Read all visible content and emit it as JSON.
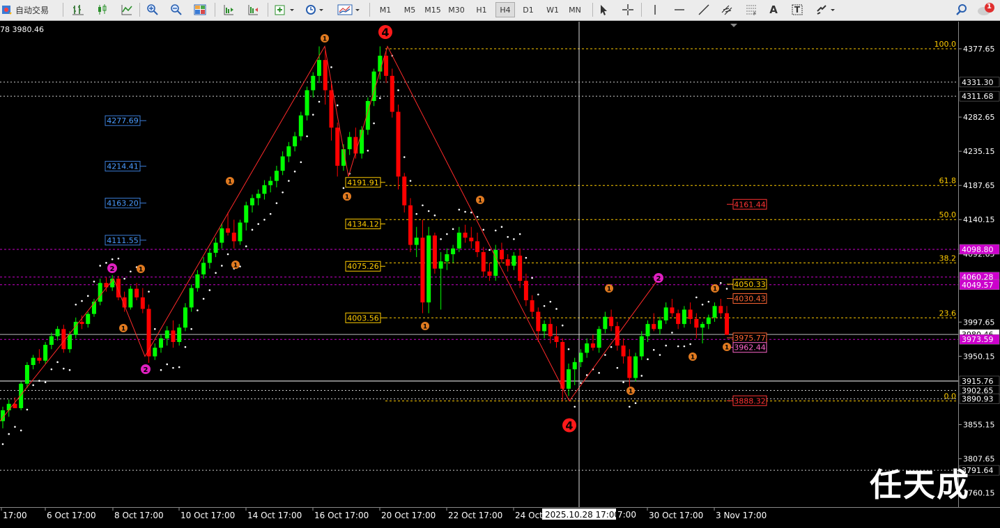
{
  "toolbar": {
    "autotrade_label": "自动交易",
    "timeframes": [
      "M1",
      "M5",
      "M15",
      "M30",
      "H1",
      "H4",
      "D1",
      "W1",
      "MN"
    ],
    "notification_count": "1",
    "tools": {
      "text_tool": "A",
      "label_tool": "T"
    }
  },
  "chart_info": {
    "ohlc_text": "78 3980.46"
  },
  "price_axis": {
    "ticks": [
      "4377.65",
      "4282.65",
      "4235.15",
      "4187.65",
      "4140.15",
      "4092.65",
      "3997.65",
      "3950.15",
      "3855.15",
      "3807.65",
      "3760.15"
    ],
    "highlighted": [
      {
        "text": "4331.30",
        "color": "#ffffff",
        "bg": "#000000"
      },
      {
        "text": "4311.68",
        "color": "#ffffff",
        "bg": "#000000"
      },
      {
        "text": "4098.80",
        "color": "#ffffff",
        "bg": "#cc00cc"
      },
      {
        "text": "4060.28",
        "color": "#ffffff",
        "bg": "#cc00cc"
      },
      {
        "text": "4049.57",
        "color": "#ffffff",
        "bg": "#cc00cc"
      },
      {
        "text": "3980.46",
        "color": "#000000",
        "bg": "#ffffff"
      },
      {
        "text": "3973.59",
        "color": "#ffffff",
        "bg": "#cc00cc"
      },
      {
        "text": "3915.76",
        "color": "#ffffff",
        "bg": "#000000"
      },
      {
        "text": "3902.65",
        "color": "#ffffff",
        "bg": "#000000"
      },
      {
        "text": "3890.93",
        "color": "#ffffff",
        "bg": "#000000"
      },
      {
        "text": "3791.64",
        "color": "#ffffff",
        "bg": "#000000"
      }
    ]
  },
  "time_axis": {
    "labels": [
      "17:00",
      "6 Oct 17:00",
      "8 Oct 17:00",
      "10 Oct 17:00",
      "14 Oct 17:00",
      "16 Oct 17:00",
      "20 Oct 17:00",
      "22 Oct 17:00",
      "24 Oct",
      "30 Oct 17:00",
      "3 Nov 17:00"
    ],
    "cursor_label": "2025.10.28 17:00",
    "cursor_suffix": "7:00"
  },
  "fibonacci": {
    "levels": [
      {
        "ratio": "100.0",
        "price": 4377.65
      },
      {
        "ratio": "61.8",
        "price": 4187.65
      },
      {
        "ratio": "50.0",
        "price": 4140.15
      },
      {
        "ratio": "38.2",
        "price": 4080.0
      },
      {
        "ratio": "23.6",
        "price": 4003.56
      },
      {
        "ratio": "0.0",
        "price": 3888.0
      }
    ]
  },
  "price_boxes": {
    "blue": [
      "4277.69",
      "4214.41",
      "4163.20",
      "4111.55"
    ],
    "orange": [
      "4191.91",
      "4134.12",
      "4075.26",
      "4003.56"
    ],
    "right_labels": [
      {
        "text": "4161.44",
        "color": "#ff3333"
      },
      {
        "text": "4050.33",
        "color": "#ffcc00"
      },
      {
        "text": "4030.43",
        "color": "#ff6633"
      },
      {
        "text": "3975.77",
        "color": "#ff6633"
      },
      {
        "text": "3962.44",
        "color": "#ff66cc"
      },
      {
        "text": "3888.32",
        "color": "#ff3333"
      }
    ]
  },
  "wave_labels": {
    "big": [
      {
        "text": "4"
      },
      {
        "text": "4"
      }
    ],
    "magenta": [
      "2",
      "2",
      "2"
    ],
    "orange": [
      "1",
      "1",
      "1",
      "1",
      "1",
      "1",
      "1",
      "1",
      "1",
      "1",
      "1",
      "1",
      "1",
      "1"
    ]
  },
  "chart_data": {
    "type": "candlestick",
    "symbol_hint": "XAUUSD H4",
    "y_range": [
      3715,
      4420
    ],
    "candles": [
      [
        3860,
        3880,
        3850,
        3875
      ],
      [
        3875,
        3890,
        3866,
        3884
      ],
      [
        3884,
        3893,
        3878,
        3878
      ],
      [
        3878,
        3915,
        3875,
        3912
      ],
      [
        3912,
        3942,
        3906,
        3938
      ],
      [
        3938,
        3952,
        3932,
        3948
      ],
      [
        3948,
        3960,
        3940,
        3944
      ],
      [
        3944,
        3970,
        3940,
        3966
      ],
      [
        3966,
        3983,
        3960,
        3978
      ],
      [
        3978,
        3992,
        3972,
        3988
      ],
      [
        3988,
        3994,
        3955,
        3960
      ],
      [
        3960,
        3985,
        3955,
        3980
      ],
      [
        3980,
        4004,
        3975,
        3998
      ],
      [
        3998,
        4007,
        3988,
        3995
      ],
      [
        3995,
        4012,
        3990,
        4009
      ],
      [
        4009,
        4030,
        4005,
        4026
      ],
      [
        4026,
        4058,
        4021,
        4052
      ],
      [
        4052,
        4060,
        4040,
        4046
      ],
      [
        4046,
        4063,
        4041,
        4058
      ],
      [
        4058,
        4062,
        4028,
        4032
      ],
      [
        4032,
        4040,
        4012,
        4018
      ],
      [
        4018,
        4048,
        4015,
        4044
      ],
      [
        4044,
        4052,
        4028,
        4032
      ],
      [
        4032,
        4045,
        4010,
        4016
      ],
      [
        4016,
        4022,
        3941,
        3950
      ],
      [
        3950,
        3968,
        3945,
        3962
      ],
      [
        3962,
        3980,
        3955,
        3975
      ],
      [
        3975,
        3992,
        3965,
        3986
      ],
      [
        3986,
        4000,
        3962,
        3970
      ],
      [
        3970,
        3995,
        3965,
        3990
      ],
      [
        3990,
        4024,
        3985,
        4018
      ],
      [
        4018,
        4050,
        4012,
        4045
      ],
      [
        4045,
        4070,
        4040,
        4064
      ],
      [
        4064,
        4088,
        4058,
        4080
      ],
      [
        4080,
        4100,
        4072,
        4094
      ],
      [
        4094,
        4115,
        4088,
        4108
      ],
      [
        4108,
        4135,
        4100,
        4128
      ],
      [
        4128,
        4150,
        4118,
        4122
      ],
      [
        4122,
        4140,
        4100,
        4110
      ],
      [
        4110,
        4140,
        4105,
        4136
      ],
      [
        4136,
        4165,
        4125,
        4160
      ],
      [
        4160,
        4175,
        4150,
        4170
      ],
      [
        4170,
        4182,
        4160,
        4176
      ],
      [
        4176,
        4195,
        4168,
        4188
      ],
      [
        4188,
        4200,
        4178,
        4194
      ],
      [
        4194,
        4215,
        4185,
        4208
      ],
      [
        4208,
        4235,
        4202,
        4228
      ],
      [
        4228,
        4248,
        4220,
        4242
      ],
      [
        4242,
        4262,
        4235,
        4256
      ],
      [
        4256,
        4290,
        4250,
        4285
      ],
      [
        4285,
        4325,
        4278,
        4320
      ],
      [
        4320,
        4345,
        4310,
        4340
      ],
      [
        4340,
        4381,
        4330,
        4362
      ],
      [
        4362,
        4376,
        4300,
        4320
      ],
      [
        4320,
        4330,
        4250,
        4268
      ],
      [
        4268,
        4275,
        4200,
        4215
      ],
      [
        4215,
        4245,
        4208,
        4238
      ],
      [
        4238,
        4262,
        4230,
        4255
      ],
      [
        4255,
        4268,
        4225,
        4232
      ],
      [
        4232,
        4270,
        4225,
        4265
      ],
      [
        4265,
        4310,
        4258,
        4305
      ],
      [
        4305,
        4350,
        4298,
        4346
      ],
      [
        4346,
        4381,
        4335,
        4368
      ],
      [
        4368,
        4375,
        4330,
        4340
      ],
      [
        4340,
        4350,
        4282,
        4290
      ],
      [
        4290,
        4300,
        4182,
        4200
      ],
      [
        4200,
        4205,
        4150,
        4160
      ],
      [
        4160,
        4170,
        4095,
        4105
      ],
      [
        4105,
        4130,
        4088,
        4115
      ],
      [
        4115,
        4140,
        4010,
        4025
      ],
      [
        4025,
        4130,
        4010,
        4118
      ],
      [
        4118,
        4122,
        4065,
        4072
      ],
      [
        4072,
        4095,
        4015,
        4082
      ],
      [
        4082,
        4100,
        4070,
        4092
      ],
      [
        4092,
        4105,
        4080,
        4100
      ],
      [
        4100,
        4130,
        4095,
        4122
      ],
      [
        4122,
        4133,
        4108,
        4115
      ],
      [
        4115,
        4130,
        4100,
        4110
      ],
      [
        4110,
        4122,
        4088,
        4095
      ],
      [
        4095,
        4102,
        4060,
        4068
      ],
      [
        4068,
        4080,
        4055,
        4062
      ],
      [
        4062,
        4105,
        4055,
        4098
      ],
      [
        4098,
        4108,
        4080,
        4085
      ],
      [
        4085,
        4092,
        4068,
        4076
      ],
      [
        4076,
        4095,
        4070,
        4090
      ],
      [
        4090,
        4100,
        4045,
        4055
      ],
      [
        4055,
        4065,
        4020,
        4028
      ],
      [
        4028,
        4035,
        4005,
        4012
      ],
      [
        4012,
        4018,
        3970,
        3985
      ],
      [
        3985,
        4000,
        3975,
        3995
      ],
      [
        3995,
        4004,
        3968,
        3978
      ],
      [
        3978,
        3992,
        3962,
        3970
      ],
      [
        3970,
        3975,
        3888,
        3905
      ],
      [
        3905,
        3940,
        3895,
        3932
      ],
      [
        3932,
        3948,
        3910,
        3942
      ],
      [
        3942,
        3960,
        3935,
        3955
      ],
      [
        3955,
        3975,
        3948,
        3968
      ],
      [
        3968,
        3980,
        3958,
        3962
      ],
      [
        3962,
        3992,
        3955,
        3988
      ],
      [
        3988,
        4012,
        3982,
        4005
      ],
      [
        4005,
        4015,
        3985,
        3992
      ],
      [
        3992,
        3998,
        3958,
        3965
      ],
      [
        3965,
        3975,
        3940,
        3950
      ],
      [
        3950,
        3960,
        3908,
        3920
      ],
      [
        3920,
        3955,
        3915,
        3950
      ],
      [
        3950,
        3985,
        3945,
        3978
      ],
      [
        3978,
        4000,
        3970,
        3995
      ],
      [
        3995,
        4010,
        3985,
        3988
      ],
      [
        3988,
        4005,
        3980,
        4000
      ],
      [
        4000,
        4025,
        3995,
        4018
      ],
      [
        4018,
        4030,
        4005,
        4010
      ],
      [
        4010,
        4015,
        3988,
        3995
      ],
      [
        3995,
        4020,
        3990,
        4015
      ],
      [
        4015,
        4025,
        3995,
        4002
      ],
      [
        4002,
        4010,
        3975,
        3990
      ],
      [
        3990,
        3998,
        3968,
        3995
      ],
      [
        3995,
        4008,
        3988,
        4004
      ],
      [
        4004,
        4025,
        3998,
        4020
      ],
      [
        4020,
        4030,
        4005,
        4010
      ],
      [
        4010,
        4020,
        3985,
        3980
      ]
    ]
  },
  "colors": {
    "bull": "#00ff00",
    "bear": "#ff0000",
    "zigzag": "#ff2a2a",
    "psar": "#ffffff",
    "fib": "#ffcc00",
    "magenta_line": "#cc00cc"
  }
}
